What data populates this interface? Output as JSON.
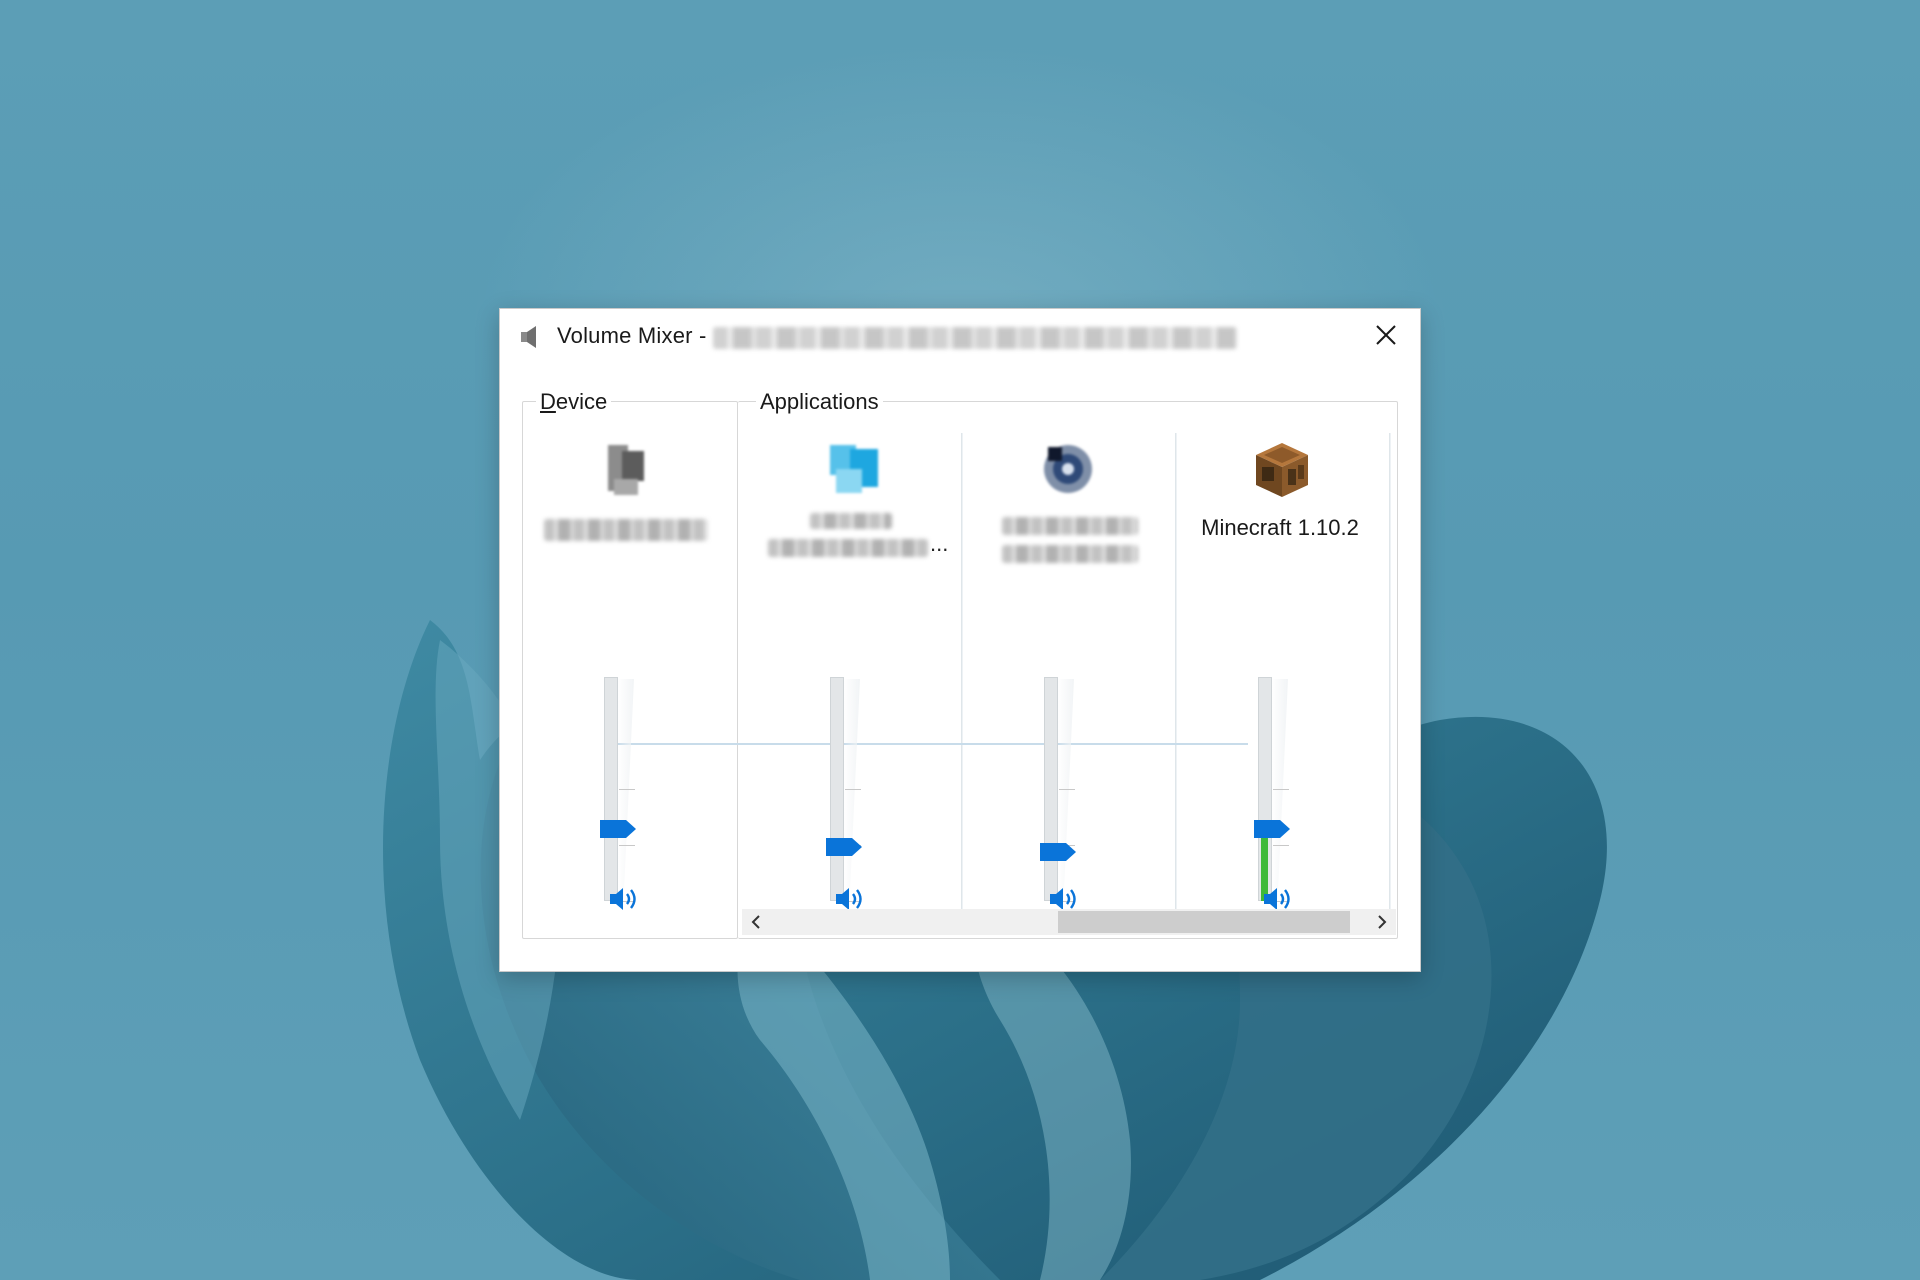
{
  "window": {
    "title_prefix": "Volume Mixer -",
    "icons": {
      "app": "speaker-icon",
      "close": "close-icon"
    }
  },
  "groups": {
    "device": {
      "label_first": "D",
      "label_rest": "evice"
    },
    "applications": {
      "label": "Applications"
    }
  },
  "channels": [
    {
      "id": "device",
      "name": "",
      "icon": "speaker-device-icon",
      "volume_percent": 32,
      "level_percent": 0,
      "mute_icon": "speaker-icon"
    },
    {
      "id": "app-1",
      "name": "",
      "icon": "app-icon-blue",
      "volume_percent": 24,
      "level_percent": 0,
      "mute_icon": "speaker-icon"
    },
    {
      "id": "app-2",
      "name": "",
      "icon": "app-icon-dark",
      "volume_percent": 22,
      "level_percent": 0,
      "mute_icon": "speaker-icon"
    },
    {
      "id": "minecraft",
      "name": "Minecraft 1.10.2",
      "icon": "crafting-table-icon",
      "volume_percent": 32,
      "level_percent": 28,
      "mute_icon": "speaker-icon"
    }
  ],
  "scrollbar": {
    "icons": {
      "left": "chevron-left-icon",
      "right": "chevron-right-icon"
    }
  },
  "colors": {
    "accent": "#0a74d9",
    "level": "#3fba3a",
    "wallpaper": "#5e9db4"
  }
}
